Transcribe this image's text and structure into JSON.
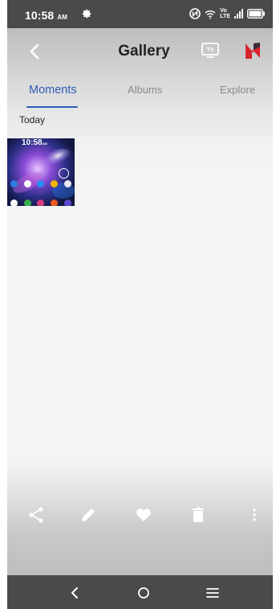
{
  "status_bar": {
    "time": "10:58",
    "ampm": "AM",
    "network": "LTE",
    "volte": "Vo"
  },
  "header": {
    "title": "Gallery",
    "back_icon": "back-arrow-icon",
    "cast_icon": "tv-cast-icon",
    "brand_icon": "brand-logo-icon"
  },
  "tabs": [
    {
      "label": "Moments",
      "active": true
    },
    {
      "label": "Albums",
      "active": false
    },
    {
      "label": "Explore",
      "active": false
    }
  ],
  "section": {
    "label": "Today"
  },
  "thumbnail": {
    "time": "10:58",
    "ampm": "AM"
  },
  "toolbar": {
    "items": [
      "share-icon",
      "edit-icon",
      "favorite-icon",
      "delete-icon",
      "more-icon"
    ]
  },
  "nav": {
    "items": [
      "nav-back-icon",
      "nav-home-icon",
      "nav-recents-icon"
    ]
  },
  "colors": {
    "accent": "#2f5bb7",
    "status_bar": "#4a4a4a",
    "nav_bar": "#4a4a4a",
    "brand": "#d9252f"
  }
}
